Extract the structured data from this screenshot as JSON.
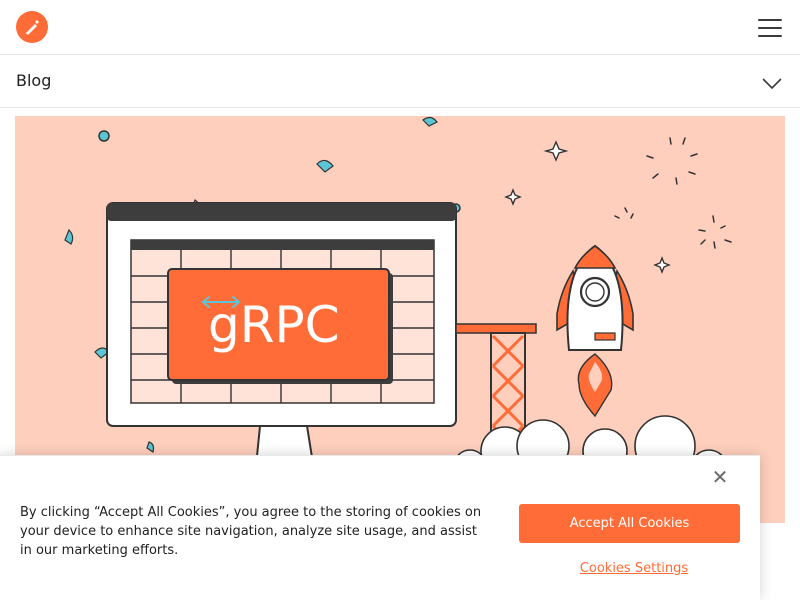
{
  "header": {
    "logo_icon": "postman-logo-icon",
    "menu_icon": "hamburger-menu-icon"
  },
  "subnav": {
    "label": "Blog",
    "icon": "chevron-down-icon"
  },
  "hero": {
    "screen_text": "gRPC",
    "background_color": "#ffcfbd",
    "accent_color": "#ff6c37"
  },
  "cookie_banner": {
    "text": "By clicking “Accept All Cookies”, you agree to the storing of cookies on your device to enhance site navigation, analyze site usage, and assist in our marketing efforts.",
    "accept_label": "Accept All Cookies",
    "settings_label": "Cookies Settings",
    "close_glyph": "✕"
  },
  "colors": {
    "brand": "#ff6c37",
    "text": "#212121",
    "border": "#e6e6e6"
  }
}
